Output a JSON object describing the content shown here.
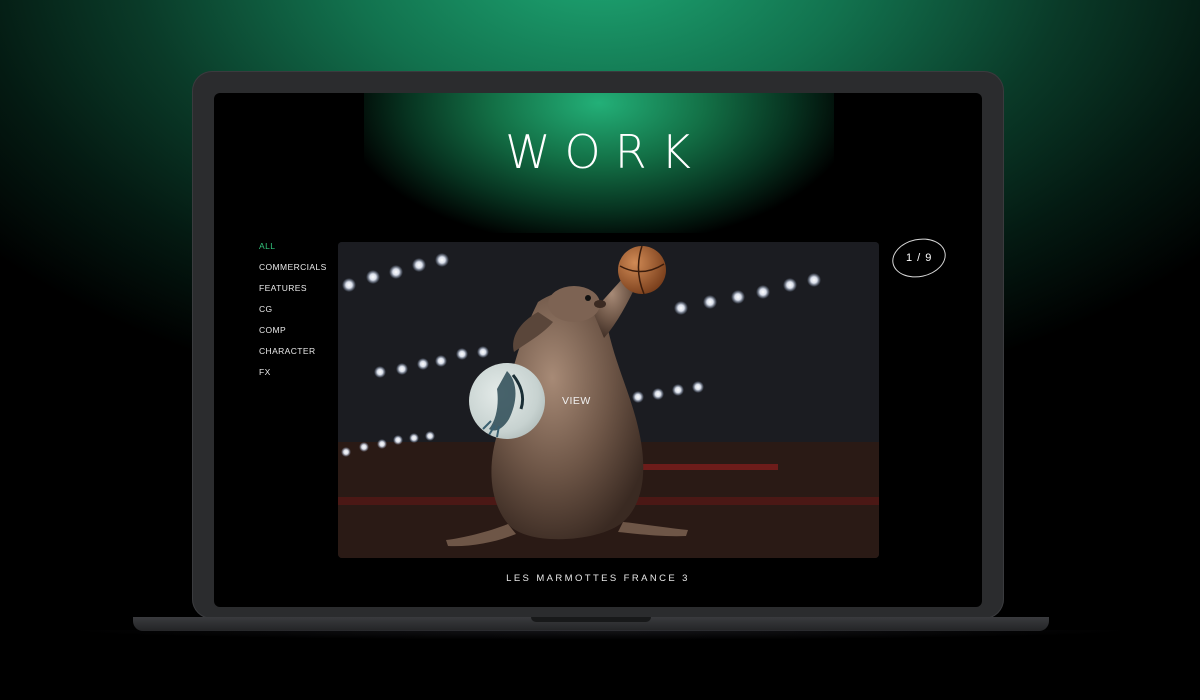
{
  "page": {
    "title": "WORK",
    "accent_color": "#32c47d"
  },
  "nav": {
    "items": [
      {
        "label": "ALL",
        "active": true
      },
      {
        "label": "COMMERCIALS",
        "active": false
      },
      {
        "label": "FEATURES",
        "active": false
      },
      {
        "label": "CG",
        "active": false
      },
      {
        "label": "COMP",
        "active": false
      },
      {
        "label": "CHARACTER",
        "active": false
      },
      {
        "label": "FX",
        "active": false
      }
    ]
  },
  "slider": {
    "counter": "1 / 9",
    "view_label": "VIEW",
    "caption": "LES MARMOTTES FRANCE 3",
    "image_subject": "marmot dunking a basketball in an arena"
  }
}
